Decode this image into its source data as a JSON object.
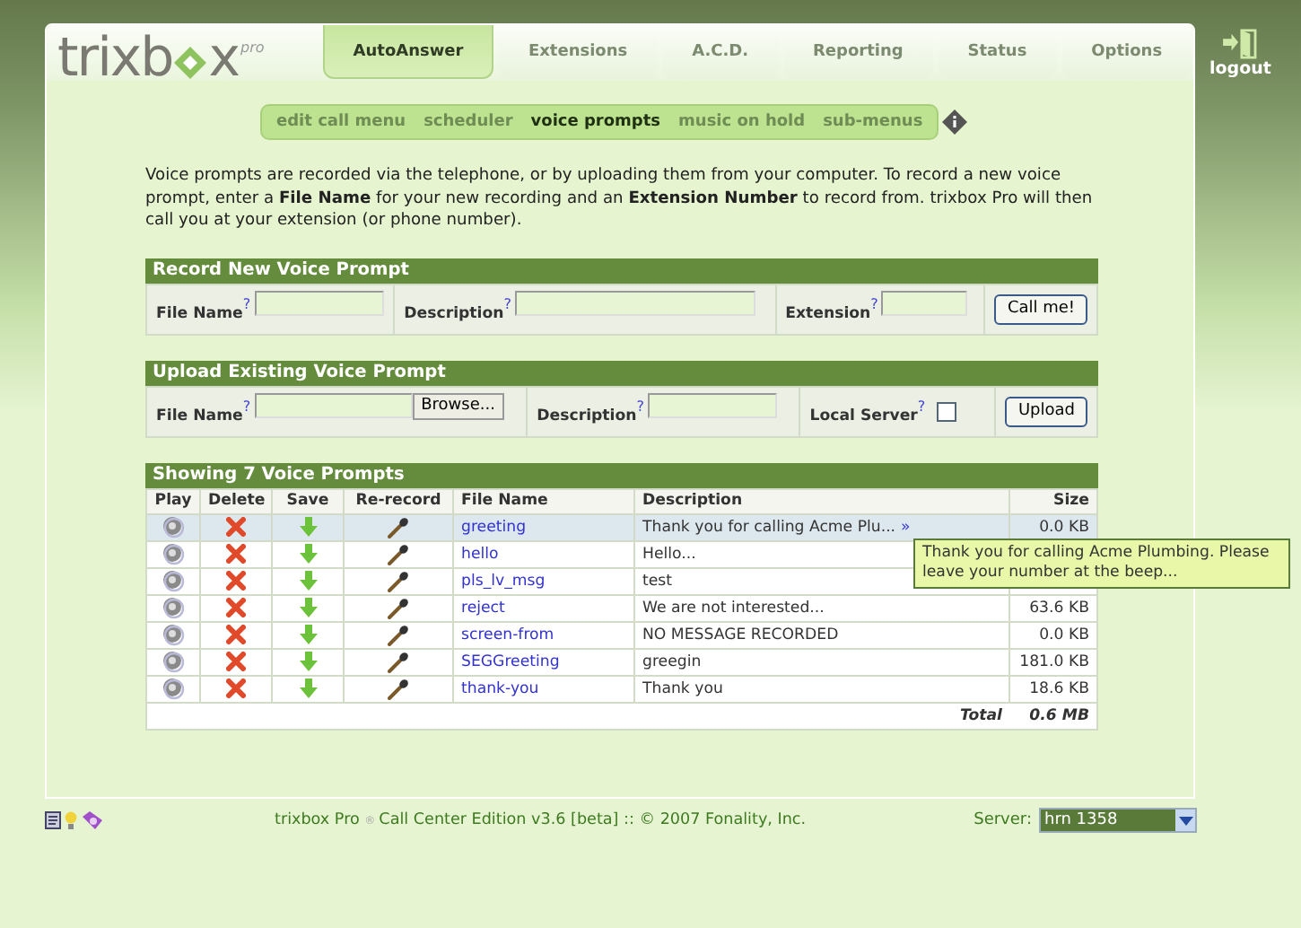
{
  "logo": {
    "left": "trixb",
    "right": "x",
    "suffix": "pro"
  },
  "tabs": [
    {
      "label": "AutoAnswer",
      "selected": true
    },
    {
      "label": "Extensions",
      "selected": false
    },
    {
      "label": "A.C.D.",
      "selected": false
    },
    {
      "label": "Reporting",
      "selected": false
    },
    {
      "label": "Status",
      "selected": false
    },
    {
      "label": "Options",
      "selected": false
    }
  ],
  "logout": "logout",
  "submenu": [
    {
      "label": "edit call menu",
      "selected": false
    },
    {
      "label": "scheduler",
      "selected": false
    },
    {
      "label": "voice prompts",
      "selected": true
    },
    {
      "label": "music on hold",
      "selected": false
    },
    {
      "label": "sub-menus",
      "selected": false
    }
  ],
  "intro": "Voice prompts are recorded via the telephone, or by uploading them from your computer. To record a new voice prompt, enter a **File Name** for your new recording and an **Extension Number** to record from. trixbox Pro will then call you at your extension (or phone number).",
  "record": {
    "title": "Record New Voice Prompt",
    "fields": [
      {
        "label": "File Name",
        "help": "?"
      },
      {
        "label": "Description",
        "help": "?"
      },
      {
        "label": "Extension",
        "help": "?"
      }
    ],
    "button": "Call me!"
  },
  "upload": {
    "title": "Upload Existing Voice Prompt",
    "file": {
      "label": "File Name",
      "help": "?",
      "browse": "Browse..."
    },
    "description": {
      "label": "Description",
      "help": "?"
    },
    "local": {
      "label": "Local Server",
      "help": "?",
      "checked": false
    },
    "button": "Upload"
  },
  "table": {
    "title": "Showing 7 Voice Prompts",
    "columns": [
      "Play",
      "Delete",
      "Save",
      "Re-record",
      "File Name",
      "Description",
      "Size"
    ],
    "rows": [
      {
        "file": "greeting",
        "description": "Thank you for calling Acme Plu...",
        "more": "»",
        "size": "0.0 KB",
        "selected": true
      },
      {
        "file": "hello",
        "description": "Hello...",
        "selected": false
      },
      {
        "file": "pls_lv_msg",
        "description": "test",
        "selected": false
      },
      {
        "file": "reject",
        "description": "We are not interested...",
        "size": "63.6 KB",
        "selected": false
      },
      {
        "file": "screen-from",
        "description": "NO MESSAGE RECORDED",
        "size": "0.0 KB",
        "selected": false
      },
      {
        "file": "SEGGreeting",
        "description": "greegin",
        "size": "181.0 KB",
        "selected": false
      },
      {
        "file": "thank-you",
        "description": "Thank you",
        "size": "18.6 KB",
        "selected": false
      }
    ],
    "total_label": "Total",
    "total": "0.6 MB"
  },
  "tooltip": "Thank you for calling Acme Plumbing. Please leave your number at the beep...",
  "footer": {
    "product": "trixbox Pro",
    "mark": "®",
    "text": "Call Center Edition v3.6 [beta]  ::  © 2007  Fonality, Inc.",
    "server_label": "Server:",
    "server": "hrn 1358"
  }
}
